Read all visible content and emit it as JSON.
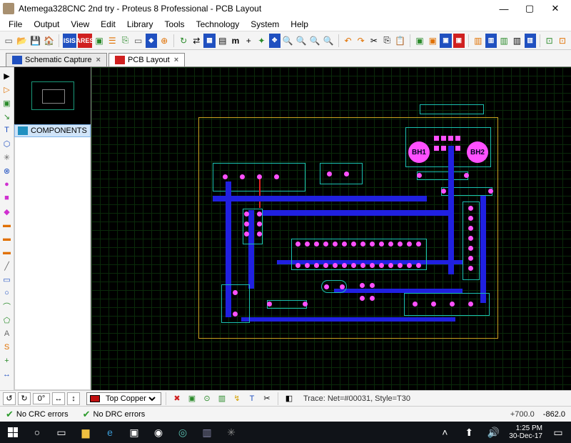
{
  "window": {
    "title": "Atemega328CNC 2nd try - Proteus 8 Professional - PCB Layout",
    "min": "—",
    "max": "▢",
    "close": "✕"
  },
  "menu": [
    "File",
    "Output",
    "View",
    "Edit",
    "Library",
    "Tools",
    "Technology",
    "System",
    "Help"
  ],
  "tabs": {
    "schematic": "Schematic Capture",
    "pcb": "PCB Layout"
  },
  "sidepanel": {
    "components_header": "COMPONENTS"
  },
  "layer": {
    "selected": "Top Copper"
  },
  "bottom1": {
    "rot": "0°",
    "trace": "Trace: Net=#00031, Style=T30"
  },
  "status": {
    "crc": "No CRC errors",
    "drc": "No DRC errors",
    "x": "+700.0",
    "y": "-862.0"
  },
  "pcb_labels": {
    "bh1": "BH1",
    "bh2": "BH2"
  },
  "taskbar": {
    "time": "1:25 PM",
    "date": "30-Dec-17"
  }
}
